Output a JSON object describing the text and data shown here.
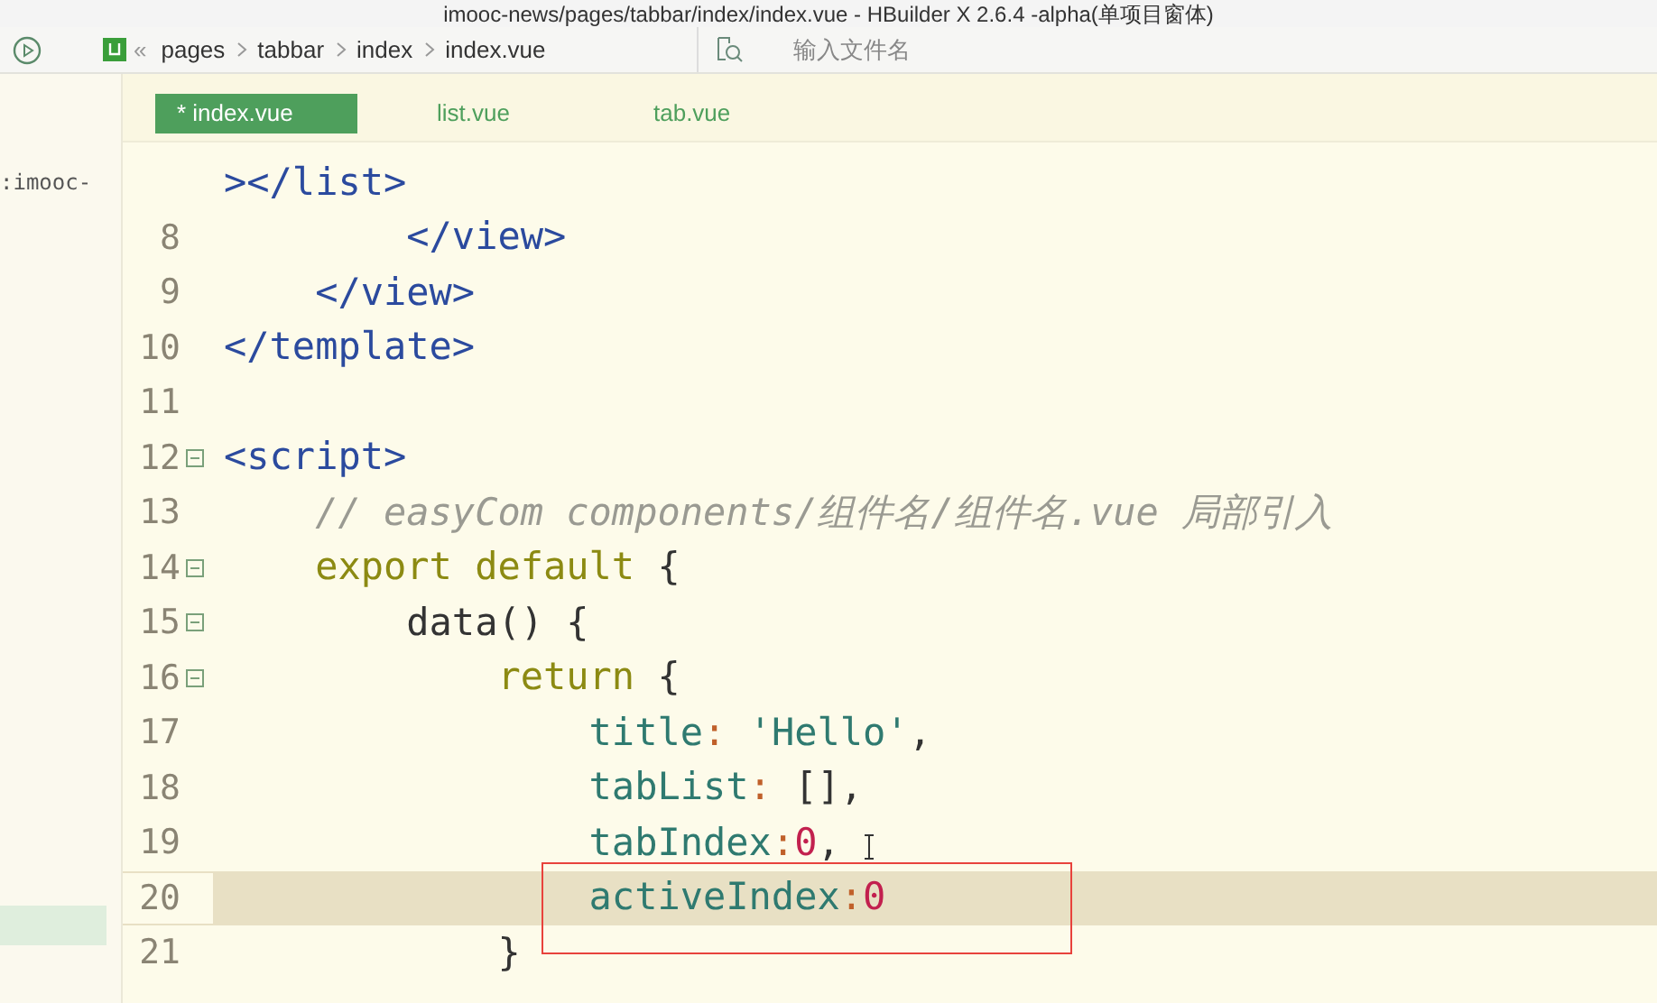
{
  "window": {
    "title": "imooc-news/pages/tabbar/index/index.vue - HBuilder X 2.6.4 -alpha(单项目窗体)"
  },
  "breadcrumb": {
    "back": "«",
    "items": [
      "pages",
      "tabbar",
      "index",
      "index.vue"
    ]
  },
  "file_search": {
    "placeholder": "输入文件名"
  },
  "sidebar": {
    "items": [
      {
        "label": ":imooc-",
        "selected": false
      },
      {
        "selected": true
      }
    ]
  },
  "tabs": [
    {
      "label": "* index.vue",
      "selected": true
    },
    {
      "label": "list.vue",
      "selected": false
    },
    {
      "label": "tab.vue",
      "selected": false
    }
  ],
  "editor": {
    "lines": [
      {
        "fold": false,
        "current": false,
        "tokens": [
          {
            "kind": "tag",
            "text": "></list>"
          }
        ]
      },
      {
        "number": "8",
        "fold": false,
        "current": false,
        "tokens": [
          {
            "kind": "tag",
            "text": "        </view>"
          }
        ]
      },
      {
        "number": "9",
        "fold": false,
        "current": false,
        "tokens": [
          {
            "kind": "tag",
            "text": "    </view>"
          }
        ]
      },
      {
        "number": "10",
        "fold": false,
        "current": false,
        "tokens": [
          {
            "kind": "tag",
            "text": "</template>"
          }
        ]
      },
      {
        "number": "11",
        "fold": false,
        "current": false
      },
      {
        "number": "12",
        "fold": true,
        "current": false,
        "tokens": [
          {
            "kind": "tag",
            "text": "<script>"
          }
        ]
      },
      {
        "number": "13",
        "fold": false,
        "current": false,
        "tokens": [
          {
            "kind": "comment",
            "text": "    // easyCom components/组件名/组件名.vue 局部引入"
          }
        ]
      },
      {
        "number": "14",
        "fold": true,
        "current": false,
        "tokens": [
          {
            "kind": "keyword",
            "text": "    export default"
          },
          {
            "kind": "plain",
            "text": " {"
          }
        ]
      },
      {
        "number": "15",
        "fold": true,
        "current": false,
        "tokens": [
          {
            "kind": "plain",
            "text": "        data() {"
          }
        ]
      },
      {
        "number": "16",
        "fold": true,
        "current": false,
        "tokens": [
          {
            "kind": "keyword",
            "text": "            return"
          },
          {
            "kind": "plain",
            "text": " {"
          }
        ]
      },
      {
        "number": "17",
        "fold": false,
        "current": false,
        "tokens": [
          {
            "kind": "prop",
            "text": "                title"
          },
          {
            "kind": "colon",
            "text": ":"
          },
          {
            "kind": "string",
            "text": " 'Hello'"
          },
          {
            "kind": "plain",
            "text": ","
          }
        ]
      },
      {
        "number": "18",
        "fold": false,
        "current": false,
        "tokens": [
          {
            "kind": "prop",
            "text": "                tabList"
          },
          {
            "kind": "colon",
            "text": ":"
          },
          {
            "kind": "plain",
            "text": " [],"
          }
        ]
      },
      {
        "number": "19",
        "fold": false,
        "current": false,
        "tokens": [
          {
            "kind": "prop",
            "text": "                tabIndex"
          },
          {
            "kind": "colon",
            "text": ":"
          },
          {
            "kind": "number",
            "text": "0"
          },
          {
            "kind": "plain",
            "text": ","
          }
        ]
      },
      {
        "number": "20",
        "fold": false,
        "current": true,
        "tokens": [
          {
            "kind": "prop",
            "text": "                activeIndex"
          },
          {
            "kind": "colon",
            "text": ":"
          },
          {
            "kind": "number",
            "text": "0"
          }
        ]
      },
      {
        "number": "21",
        "fold": false,
        "current": false,
        "tokens": [
          {
            "kind": "plain",
            "text": "            }"
          }
        ]
      }
    ]
  }
}
